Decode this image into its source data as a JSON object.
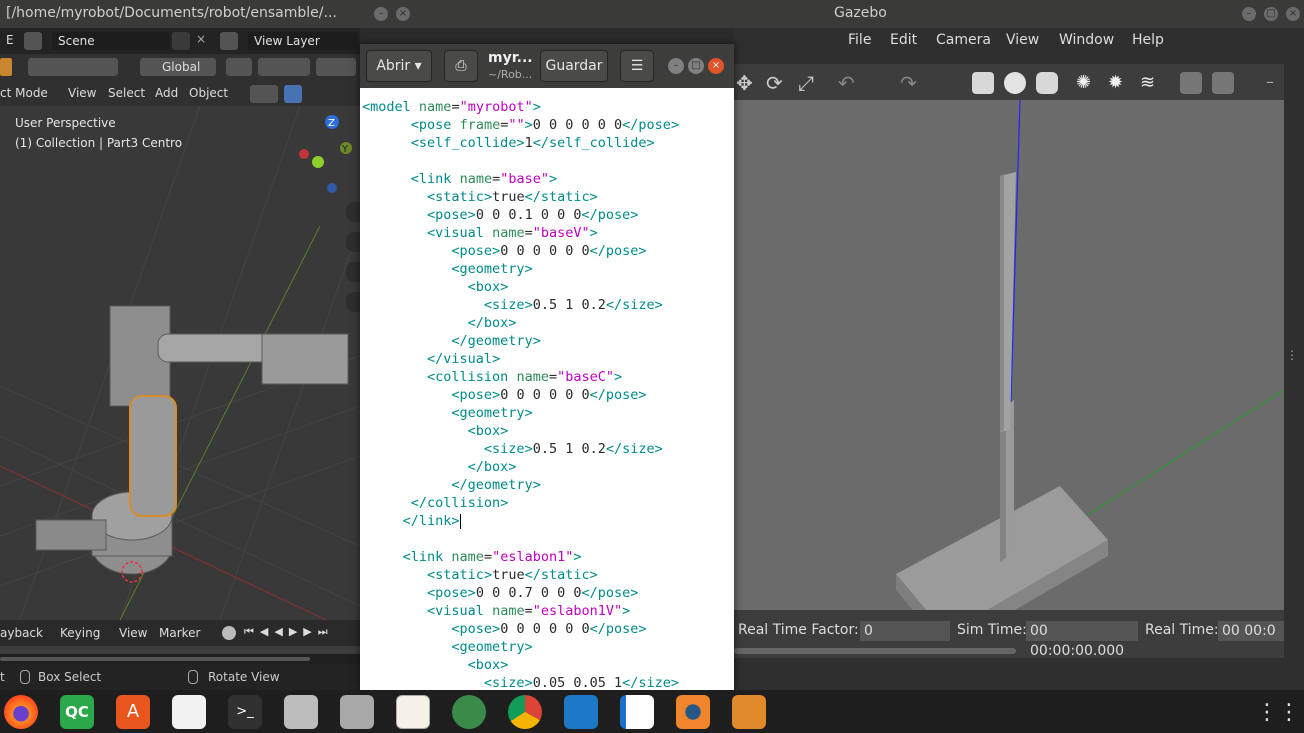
{
  "topbar": {
    "left_title": "[/home/myrobot/Documents/robot/ensamble/...",
    "right_title": "Gazebo"
  },
  "blender": {
    "header": {
      "editor_letter": "E",
      "scene": "Scene",
      "view_layer": "View Layer"
    },
    "toolbar": {
      "orientation": "Global"
    },
    "menu": {
      "mode": "ct Mode",
      "view": "View",
      "select": "Select",
      "add": "Add",
      "object": "Object"
    },
    "viewport": {
      "perspective": "User Perspective",
      "collection": "(1) Collection | Part3 Centro",
      "axis_z": "Z",
      "axis_y": "Y"
    },
    "timeline": {
      "playback": "ayback",
      "keying": "Keying",
      "view": "View",
      "marker": "Marker"
    },
    "status": {
      "left": "t",
      "box_select": "Box Select",
      "rotate_view": "Rotate View"
    }
  },
  "gazebo": {
    "menu": {
      "file": "File",
      "edit": "Edit",
      "camera": "Camera",
      "view": "View",
      "window": "Window",
      "help": "Help"
    },
    "bottom": {
      "rtf_label": "Real Time Factor:",
      "rtf_value": "0",
      "sim_label": "Sim Time:",
      "sim_value": "00 00:00:00.000",
      "real_label": "Real Time:",
      "real_value": "00 00:0"
    }
  },
  "editor": {
    "open_label": "Abrir",
    "title": "myr...",
    "subtitle": "~/Rob...",
    "save_label": "Guardar",
    "lines": [
      "<model name=\"myrobot\">",
      "      <pose frame=\"\">0 0 0 0 0 0</pose>",
      "      <self_collide>1</self_collide>",
      "",
      "      <link name=\"base\">",
      "        <static>true</static>",
      "        <pose>0 0 0.1 0 0 0</pose>",
      "        <visual name=\"baseV\">",
      "           <pose>0 0 0 0 0 0</pose>",
      "           <geometry>",
      "             <box>",
      "               <size>0.5 1 0.2</size>",
      "             </box>",
      "           </geometry>",
      "        </visual>",
      "        <collision name=\"baseC\">",
      "           <pose>0 0 0 0 0 0</pose>",
      "           <geometry>",
      "             <box>",
      "               <size>0.5 1 0.2</size>",
      "             </box>",
      "           </geometry>",
      "      </collision>",
      "     </link>",
      "",
      "     <link name=\"eslabon1\">",
      "        <static>true</static>",
      "        <pose>0 0 0.7 0 0 0</pose>",
      "        <visual name=\"eslabon1V\">",
      "           <pose>0 0 0 0 0 0</pose>",
      "           <geometry>",
      "             <box>",
      "               <size>0.05 0.05 1</size>"
    ]
  },
  "dock": {
    "items": [
      "firefox-icon",
      "qc-icon",
      "software-center-icon",
      "text-editor-icon-red",
      "terminal-icon",
      "camera-icon",
      "files-icon",
      "gedit-icon",
      "atom-icon",
      "chrome-icon",
      "vscode-icon",
      "writer-icon",
      "blender-icon",
      "box-icon"
    ],
    "qc_label": "QC"
  }
}
